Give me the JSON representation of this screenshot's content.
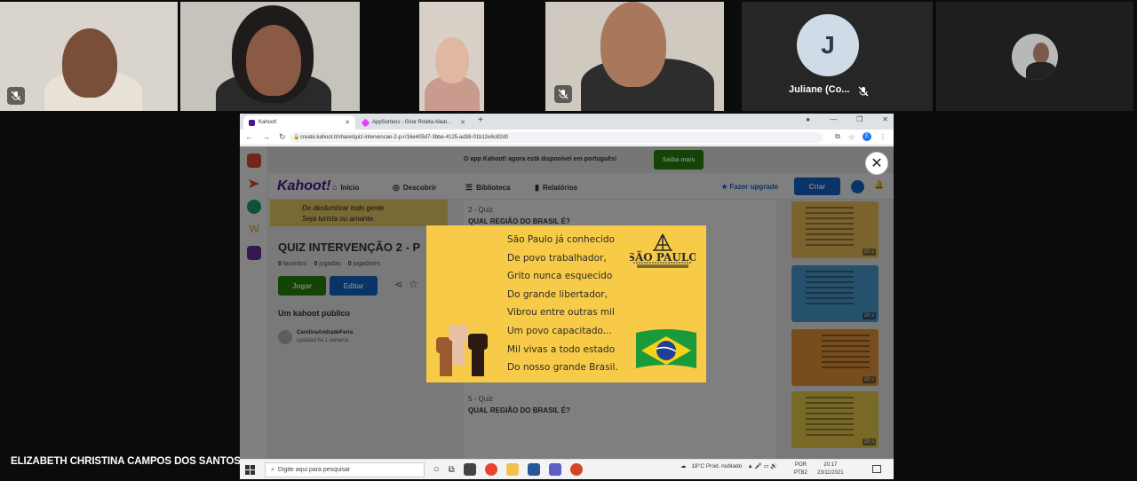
{
  "participants": [
    {
      "id": "p1",
      "muted": true
    },
    {
      "id": "p2",
      "muted": false
    },
    {
      "id": "p3",
      "muted": false
    },
    {
      "id": "p4",
      "muted": true
    },
    {
      "id": "juliane",
      "initial": "J",
      "name": "Juliane (Co...",
      "muted": true
    },
    {
      "id": "p6",
      "muted": false
    }
  ],
  "speaker_name": "ELIZABETH CHRISTINA CAMPOS DOS SANTOS",
  "browser": {
    "tabs": [
      {
        "label": "Kahoot!",
        "favicon_color": "#46178f"
      },
      {
        "label": "AppSorteos - Girar Roleta Aleat...",
        "favicon_color": "#e040fb"
      }
    ],
    "new_tab": "+",
    "url": "create.kahoot.it/share/quiz-intervencao-2-p-r/16e405d7-3bbe-4125-ad38-01b12e6c82d0",
    "profile_initial": "E"
  },
  "kahoot": {
    "banner_text": "O app Kahoot! agora está disponível em português!",
    "banner_button": "Saiba mais",
    "close": "✕",
    "logo": "Kahoot!",
    "nav": [
      "Início",
      "Descobrir",
      "Biblioteca",
      "Relatórios"
    ],
    "upgrade": "Fazer upgrade",
    "create": "Criar",
    "cover_lines": [
      "De deslumbrar todo gente",
      "Seja turista ou amante."
    ],
    "quiz_title": "QUIZ INTERVENÇÃO 2 - P",
    "stats": {
      "favoritos_count": "0",
      "favoritos": "favoritos",
      "jogadas_count": "0",
      "jogadas": "jogadas",
      "jogadores_count": "0",
      "jogadores": "jogadores"
    },
    "play": "Jogar",
    "edit": "Editar",
    "visibility": "Um kahoot público",
    "author": "CarolinaAndradeFerra",
    "updated": "updated há 1 semana",
    "questions": [
      {
        "num": "2 - Quiz",
        "title": "QUAL REGIÃO DO BRASIL É?"
      },
      {
        "num": "5 - Quiz",
        "title": "QUAL REGIÃO DO BRASIL É?"
      }
    ],
    "thumb_badges": [
      "20 s",
      "20 s",
      "20 s",
      "20 s"
    ]
  },
  "poem": {
    "lines": [
      "São Paulo já conhecido",
      "De povo trabalhador,",
      "Grito nunca esquecido",
      "Do grande libertador,",
      "Vibrou entre outras mil",
      "Um povo capacitado...",
      "Mil vivas a todo estado",
      "Do nosso grande Brasil."
    ],
    "logo_text": "SÃO PAULO",
    "background": "#f7cb48"
  },
  "taskbar": {
    "search_placeholder": "Digite aqui para pesquisar",
    "weather": "18°C  Prod. nublado",
    "lang_top": "POR",
    "lang_bottom": "PTB2",
    "time": "20:17",
    "date": "23/11/2021"
  }
}
